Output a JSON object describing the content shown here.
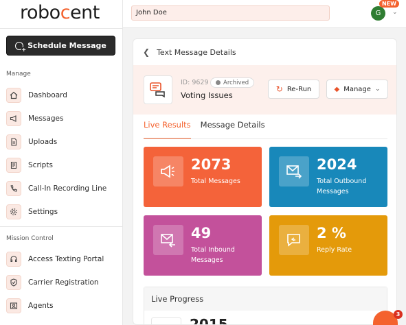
{
  "brand": {
    "logo_text_a": "robo",
    "logo_text_c": "c",
    "logo_text_b": "ent",
    "accent": "#f4622e"
  },
  "sidebar": {
    "schedule_label": "Schedule Message",
    "section_manage": "Manage",
    "section_mission": "Mission Control",
    "items": [
      {
        "label": "Dashboard",
        "icon": "home-icon"
      },
      {
        "label": "Messages",
        "icon": "megaphone-icon"
      },
      {
        "label": "Uploads",
        "icon": "file-icon"
      },
      {
        "label": "Scripts",
        "icon": "script-icon"
      },
      {
        "label": "Call-In Recording Line",
        "icon": "phone-icon"
      },
      {
        "label": "Settings",
        "icon": "gear-icon"
      }
    ],
    "mission_items": [
      {
        "label": "Access Texting Portal",
        "icon": "headset-icon"
      },
      {
        "label": "Carrier Registration",
        "icon": "shield-icon"
      },
      {
        "label": "Agents",
        "icon": "agent-icon"
      }
    ]
  },
  "topbar": {
    "search_value": "John Doe",
    "avatar_initial": "G",
    "new_badge": "NEW"
  },
  "details": {
    "back_label": "Text Message Details",
    "id_text": "ID: 9629",
    "archived_label": "Archived",
    "title": "Voting Issues",
    "rerun_label": "Re-Run",
    "manage_label": "Manage"
  },
  "tabs": {
    "live": "Live Results",
    "details": "Message Details"
  },
  "stats": [
    {
      "value": "2073",
      "label": "Total Messages",
      "color": "#f4633a",
      "icon": "megaphone-icon"
    },
    {
      "value": "2024",
      "label": "Total Outbound Messages",
      "color": "#1888ba",
      "icon": "outbound-mail-icon"
    },
    {
      "value": "49",
      "label": "Total Inbound Messages",
      "color": "#c3519b",
      "icon": "inbound-mail-icon"
    },
    {
      "value": "2 %",
      "label": "Reply Rate",
      "color": "#e49a0a",
      "icon": "reply-chat-icon"
    }
  ],
  "progress": {
    "title": "Live Progress",
    "value": "2015"
  },
  "chat": {
    "badge": "3"
  }
}
